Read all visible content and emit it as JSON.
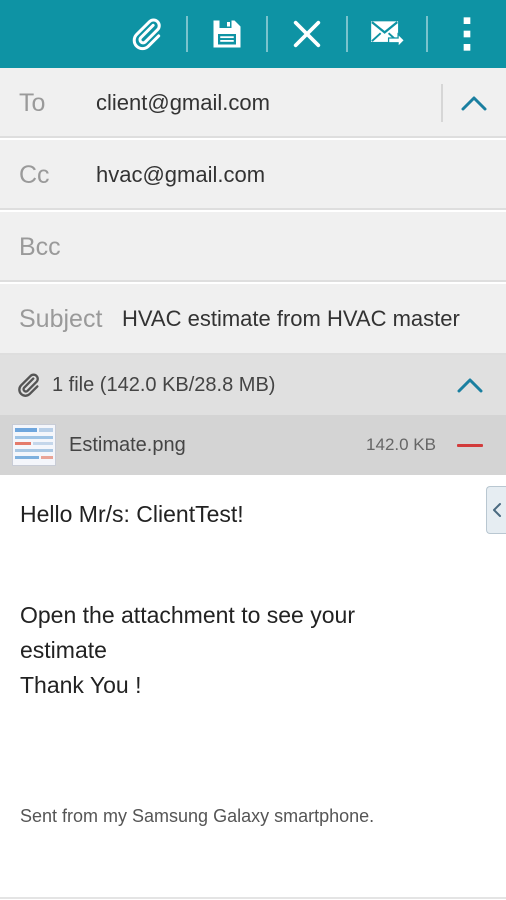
{
  "toolbar": {
    "buttons": [
      {
        "icon": "paperclip-icon"
      },
      {
        "icon": "save-icon"
      },
      {
        "icon": "close-icon"
      },
      {
        "icon": "send-icon"
      },
      {
        "icon": "more-vertical-icon"
      }
    ],
    "color": "#0e93a4"
  },
  "to": {
    "label": "To",
    "value": "client@gmail.com"
  },
  "cc": {
    "label": "Cc",
    "value": "hvac@gmail.com"
  },
  "bcc": {
    "label": "Bcc",
    "value": ""
  },
  "subject": {
    "label": "Subject",
    "value": "HVAC estimate from HVAC master"
  },
  "attachments": {
    "summary": "1 file (142.0 KB/28.8 MB)",
    "files": [
      {
        "name": "Estimate.png",
        "size": "142.0 KB"
      }
    ]
  },
  "body": {
    "greeting": "Hello Mr/s: ClientTest!",
    "line1": "Open the attachment to see your",
    "line2": "estimate",
    "line3": "Thank You !",
    "signature": "Sent from my Samsung Galaxy smartphone."
  },
  "colors": {
    "accent": "#0e93a4",
    "remove": "#d23b3b",
    "chevron": "#1a7fa0"
  }
}
